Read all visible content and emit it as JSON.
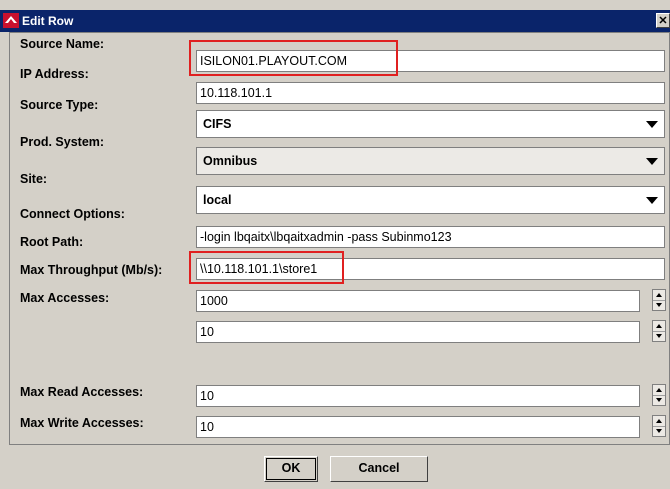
{
  "window": {
    "title": "Edit Row",
    "close_label": "✕",
    "icon": "app-logo-icon"
  },
  "fields": {
    "source_name": {
      "label": "Source Name:",
      "value": "ISILON01.PLAYOUT.COM"
    },
    "ip_address": {
      "label": "IP Address:",
      "value": "10.118.101.1"
    },
    "source_type": {
      "label": "Source Type:",
      "value": "CIFS"
    },
    "prod_system": {
      "label": "Prod. System:",
      "value": "Omnibus"
    },
    "site": {
      "label": "Site:",
      "value": "local"
    },
    "connect_options": {
      "label": "Connect Options:",
      "value": "-login lbqaitx\\lbqaitxadmin -pass Subinmo123"
    },
    "root_path": {
      "label": "Root Path:",
      "value": "\\\\10.118.101.1\\store1"
    },
    "max_throughput": {
      "label": "Max Throughput (Mb/s):",
      "value": "1000"
    },
    "max_accesses": {
      "label": "Max Accesses:",
      "value": "10"
    },
    "max_read_accesses": {
      "label": "Max Read Accesses:",
      "value": "10"
    },
    "max_write_accesses": {
      "label": "Max Write Accesses:",
      "value": "10"
    }
  },
  "buttons": {
    "ok": "OK",
    "cancel": "Cancel"
  },
  "colors": {
    "title_bar": "#0a246a",
    "dialog_bg": "#d4d0c8",
    "highlight": "#e02020"
  }
}
